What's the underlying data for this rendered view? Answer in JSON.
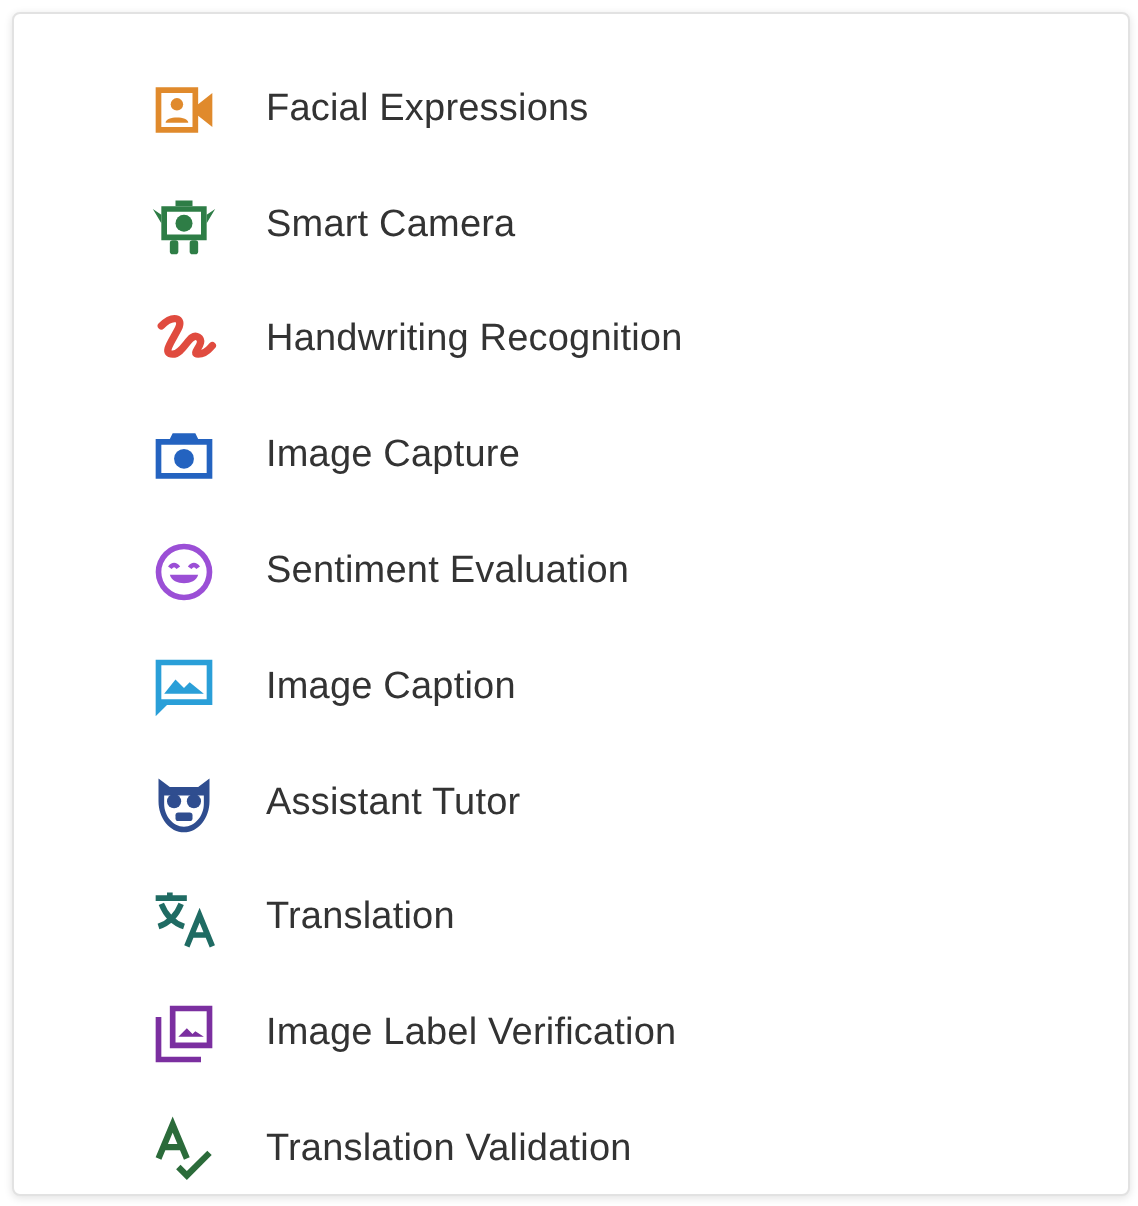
{
  "items": [
    {
      "label": "Facial Expressions",
      "kind": "video-person",
      "color": "#e08a2c"
    },
    {
      "label": "Smart Camera",
      "kind": "robot",
      "color": "#2e7d46"
    },
    {
      "label": "Handwriting Recognition",
      "kind": "scribble",
      "color": "#e04b3f"
    },
    {
      "label": "Image Capture",
      "kind": "camera",
      "color": "#2463c0"
    },
    {
      "label": "Sentiment Evaluation",
      "kind": "smiley",
      "color": "#9b4fd6"
    },
    {
      "label": "Image Caption",
      "kind": "image-bubble",
      "color": "#2a9fd8"
    },
    {
      "label": "Assistant Tutor",
      "kind": "owl",
      "color": "#2f4d8f"
    },
    {
      "label": "Translation",
      "kind": "translate",
      "color": "#1f6b63"
    },
    {
      "label": "Image Label Verification",
      "kind": "photo-stack",
      "color": "#7b2fa0"
    },
    {
      "label": "Translation Validation",
      "kind": "spellcheck",
      "color": "#2b6b3a"
    }
  ]
}
